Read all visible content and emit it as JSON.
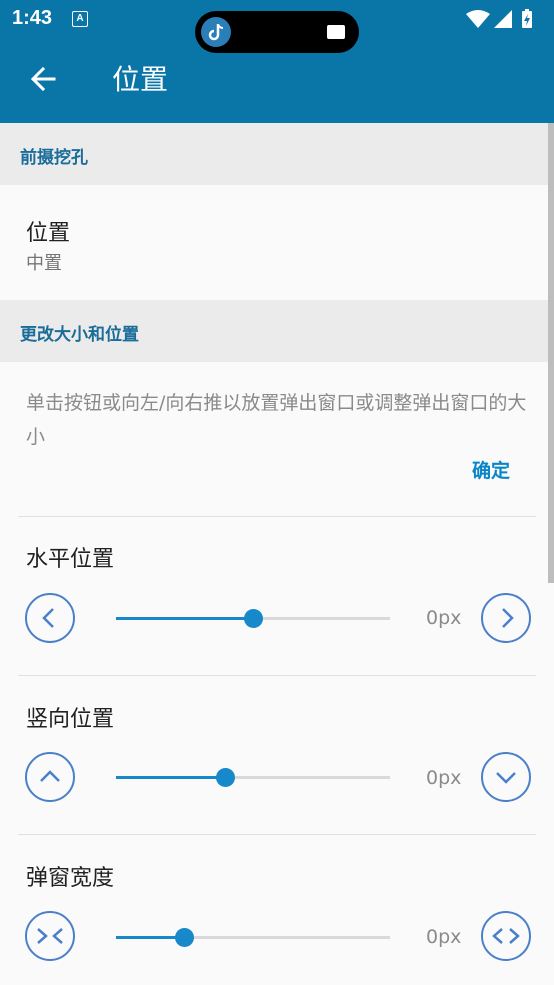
{
  "status_bar": {
    "time": "1:43",
    "notification_icon": "A"
  },
  "app_bar": {
    "title": "位置"
  },
  "sections": {
    "cutout": {
      "header": "前摄挖孔"
    },
    "resize": {
      "header": "更改大小和位置"
    }
  },
  "position_item": {
    "title": "位置",
    "value": "中置"
  },
  "instructions": {
    "text": "单击按钮或向左/向右推以放置弹出窗口或调整弹出窗口的大小",
    "ok_label": "确定"
  },
  "sliders": [
    {
      "label": "水平位置",
      "value_text": "0px",
      "fraction": 0.5,
      "dec_icon": "chevron-left-icon",
      "inc_icon": "chevron-right-icon"
    },
    {
      "label": "竖向位置",
      "value_text": "0px",
      "fraction": 0.4,
      "dec_icon": "chevron-up-icon",
      "inc_icon": "chevron-down-icon"
    },
    {
      "label": "弹窗宽度",
      "value_text": "0px",
      "fraction": 0.25,
      "dec_icon": "shrink-width-icon",
      "inc_icon": "expand-width-icon"
    }
  ],
  "colors": {
    "primary": "#0a76a8",
    "accent": "#1788c9",
    "section_text": "#1a6c99"
  }
}
